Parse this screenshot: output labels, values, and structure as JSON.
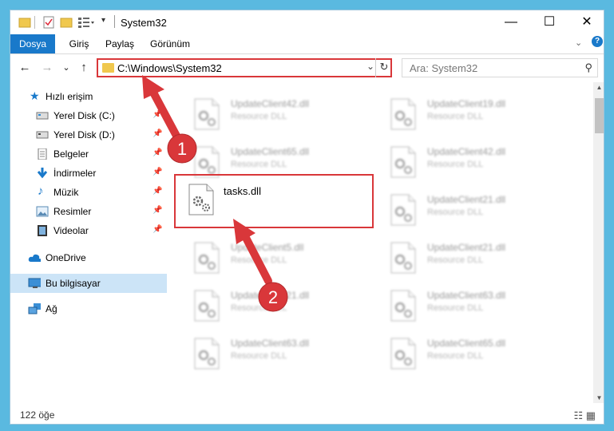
{
  "window": {
    "title": "System32",
    "controls": {
      "minimize": "—",
      "maximize": "☐",
      "close": "✕"
    }
  },
  "ribbon": {
    "tabs": [
      {
        "label": "Dosya"
      },
      {
        "label": "Giriş"
      },
      {
        "label": "Paylaş"
      },
      {
        "label": "Görünüm"
      }
    ]
  },
  "nav": {
    "back": "←",
    "forward": "→",
    "recent": "⌄",
    "up": "↑",
    "address": "C:\\Windows\\System32",
    "search_placeholder": "Ara: System32"
  },
  "sidebar": {
    "items": [
      {
        "label": "Hızlı erişim",
        "icon": "star-icon"
      },
      {
        "label": "Yerel Disk (C:)",
        "icon": "drive-icon",
        "pinned": true
      },
      {
        "label": "Yerel Disk (D:)",
        "icon": "drive-icon",
        "pinned": true
      },
      {
        "label": "Belgeler",
        "icon": "documents-icon",
        "pinned": true
      },
      {
        "label": "İndirmeler",
        "icon": "download-icon",
        "pinned": true
      },
      {
        "label": "Müzik",
        "icon": "music-icon",
        "pinned": true
      },
      {
        "label": "Resimler",
        "icon": "pictures-icon",
        "pinned": true
      },
      {
        "label": "Videolar",
        "icon": "videos-icon",
        "pinned": true
      },
      {
        "label": "OneDrive",
        "icon": "cloud-icon"
      },
      {
        "label": "Bu bilgisayar",
        "icon": "computer-icon",
        "selected": true
      },
      {
        "label": "Ağ",
        "icon": "network-icon"
      }
    ]
  },
  "files": {
    "col1": [
      {
        "name": "UpdateClient42.dll",
        "desc": "Resource DLL"
      },
      {
        "name": "UpdateClient65.dll",
        "desc": "Resource DLL"
      },
      {
        "name": "tasks.dll",
        "desc": ""
      },
      {
        "name": "UpdateClient5.dll",
        "desc": "Resource DLL"
      },
      {
        "name": "UpdateClient21.dll",
        "desc": "Resource DLL"
      },
      {
        "name": "UpdateClient63.dll",
        "desc": "Resource DLL"
      }
    ],
    "col2": [
      {
        "name": "UpdateClient19.dll",
        "desc": "Resource DLL"
      },
      {
        "name": "UpdateClient42.dll",
        "desc": "Resource DLL"
      },
      {
        "name": "UpdateClient21.dll",
        "desc": "Resource DLL"
      },
      {
        "name": "UpdateClient21.dll",
        "desc": "Resource DLL"
      },
      {
        "name": "UpdateClient63.dll",
        "desc": "Resource DLL"
      },
      {
        "name": "UpdateClient65.dll",
        "desc": "Resource DLL"
      }
    ]
  },
  "status": {
    "item_count": "122 öğe"
  },
  "annotations": {
    "step1": "1",
    "step2": "2",
    "color": "#d9373a"
  },
  "colors": {
    "accent": "#1979ca",
    "selection": "#cce4f7",
    "highlight": "#d9373a",
    "desktop": "#5ab9e0"
  }
}
